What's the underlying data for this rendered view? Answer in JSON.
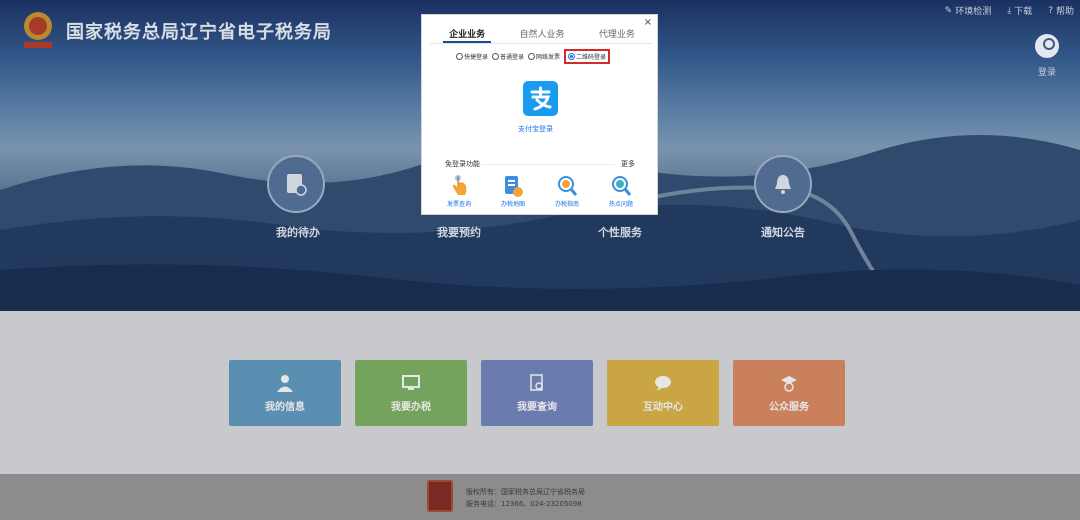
{
  "header": {
    "site_title": "国家税务总局辽宁省电子税务局",
    "toplinks": {
      "env_check": "环境检测",
      "download": "下载",
      "help": "帮助"
    },
    "login_label": "登录"
  },
  "hero_nav": [
    {
      "label": "我的待办"
    },
    {
      "label": "我要预约"
    },
    {
      "label": "个性服务"
    },
    {
      "label": "通知公告"
    }
  ],
  "tiles": [
    {
      "label": "我的信息",
      "color": "#5b8fb2"
    },
    {
      "label": "我要办税",
      "color": "#73a35d"
    },
    {
      "label": "我要查询",
      "color": "#6a7bb0"
    },
    {
      "label": "互动中心",
      "color": "#c9a643"
    },
    {
      "label": "公众服务",
      "color": "#c9805b"
    }
  ],
  "footer": {
    "copyright": "版权所有：国家税务总局辽宁省税务局",
    "phone": "服务电话：12366、024-23205098"
  },
  "modal": {
    "tabs": [
      "企业业务",
      "自然人业务",
      "代理业务"
    ],
    "active_tab": "企业业务",
    "close": "×",
    "login_modes": [
      "快捷登录",
      "普通登录",
      "网络发票",
      "二维码登录"
    ],
    "selected_mode": "二维码登录",
    "alipay_label": "支付宝登录",
    "no_login_label": "免登录功能",
    "more_label": "更多",
    "functions": [
      {
        "label": "发票查询",
        "icon": "hand-pointer-icon"
      },
      {
        "label": "办税地图",
        "icon": "map-document-icon"
      },
      {
        "label": "办税指南",
        "icon": "magnifier-guide-icon"
      },
      {
        "label": "热点问题",
        "icon": "magnifier-faq-icon"
      }
    ]
  },
  "colors": {
    "accent": "#1a73e8",
    "highlight": "#d42a2a",
    "alipay": "#1a9bf0"
  }
}
